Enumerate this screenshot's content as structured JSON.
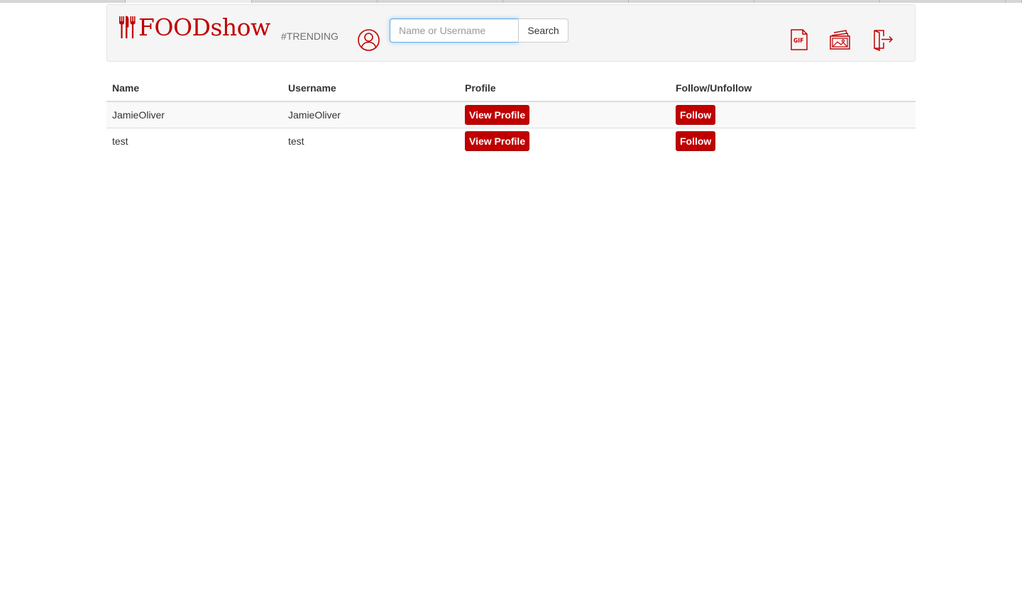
{
  "browser": {
    "tab_count": 9,
    "active_tab_index": 1
  },
  "navbar": {
    "logo_text": "FOODshow",
    "logo_icon": "fork-knife-icon",
    "trending_label": "#TRENDING",
    "profile_icon": "user-circle-icon",
    "search": {
      "placeholder": "Name or Username",
      "value": "",
      "button_label": "Search"
    },
    "right_icons": [
      "gif-icon",
      "photos-icon",
      "logout-icon"
    ]
  },
  "table": {
    "headers": [
      "Name",
      "Username",
      "Profile",
      "Follow/Unfollow"
    ],
    "rows": [
      {
        "name": "JamieOliver",
        "username": "JamieOliver",
        "profile_label": "View Profile",
        "follow_label": "Follow"
      },
      {
        "name": "test",
        "username": "test",
        "profile_label": "View Profile",
        "follow_label": "Follow"
      }
    ]
  },
  "colors": {
    "brand_red": "#c00000",
    "navbar_bg": "#f5f5f5",
    "input_focus": "#66afe9"
  }
}
